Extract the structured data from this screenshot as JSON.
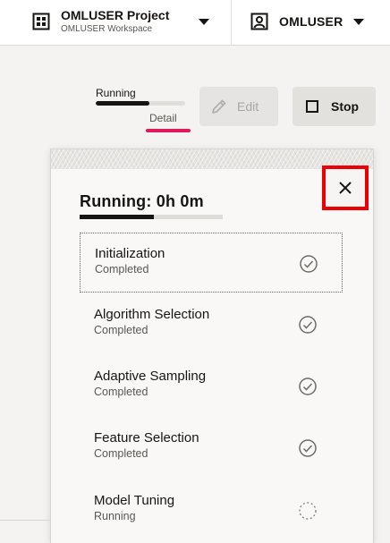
{
  "header": {
    "project_title": "OMLUSER Project",
    "project_subtitle": "OMLUSER Workspace",
    "project_icon": "grid-icon",
    "user_label": "OMLUSER",
    "user_icon": "user-icon"
  },
  "status": {
    "label": "Running",
    "progress": 0.6,
    "detail_link": "Detail"
  },
  "toolbar": {
    "edit_label": "Edit",
    "stop_label": "Stop",
    "edit_icon": "pencil-icon",
    "stop_icon": "stop-icon"
  },
  "panel": {
    "title": "Running: 0h 0m",
    "progress": 0.52,
    "close_icon": "close-icon",
    "steps": [
      {
        "name": "Initialization",
        "status": "Completed",
        "icon": "check-circle-icon"
      },
      {
        "name": "Algorithm Selection",
        "status": "Completed",
        "icon": "check-circle-icon"
      },
      {
        "name": "Adaptive Sampling",
        "status": "Completed",
        "icon": "check-circle-icon"
      },
      {
        "name": "Feature Selection",
        "status": "Completed",
        "icon": "check-circle-icon"
      },
      {
        "name": "Model Tuning",
        "status": "Running",
        "icon": "spinner-icon"
      }
    ]
  },
  "colors": {
    "accent": "#e0185c",
    "highlight_border": "#ee0000",
    "text": "#161513",
    "muted": "#5b5652",
    "background": "#f4f3f1"
  }
}
